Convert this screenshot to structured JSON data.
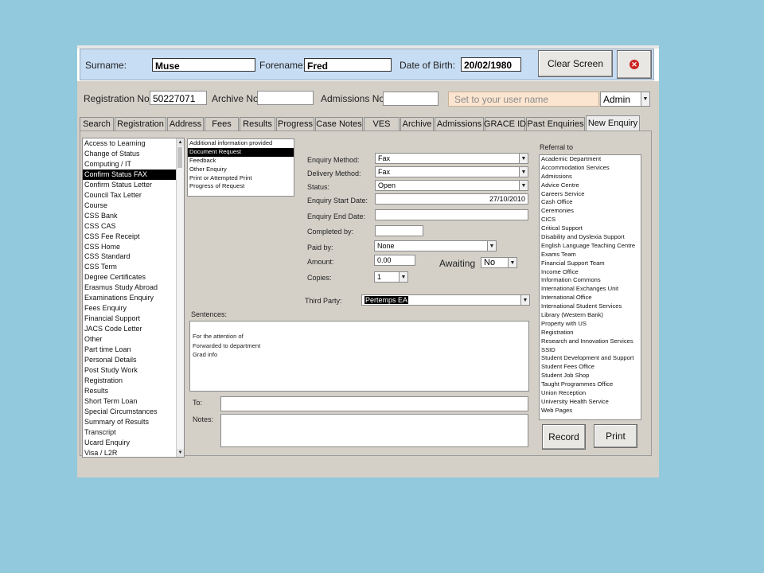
{
  "header": {
    "surname_label": "Surname:",
    "surname_value": "Muse",
    "forename_label": "Forename:",
    "forename_value": "Fred",
    "dob_label": "Date of Birth:",
    "dob_value": "20/02/1980",
    "clear_label": "Clear Screen"
  },
  "reg": {
    "registration_label": "Registration No.",
    "registration_value": "50227071",
    "archive_label": "Archive No:",
    "archive_value": "",
    "admissions_label": "Admissions No:",
    "admissions_value": "",
    "user_placeholder": "Set to your user name",
    "user_select": "Admin"
  },
  "tabs": [
    {
      "label": "Search"
    },
    {
      "label": "Registration"
    },
    {
      "label": "Address"
    },
    {
      "label": "Fees"
    },
    {
      "label": "Results"
    },
    {
      "label": "Progress"
    },
    {
      "label": "Case Notes"
    },
    {
      "label": "VES"
    },
    {
      "label": "Archive"
    },
    {
      "label": "Admissions"
    },
    {
      "label": "GRACE ID"
    },
    {
      "label": "Past Enquiries"
    },
    {
      "label": "New Enquiry"
    }
  ],
  "enquiry_types": [
    "Access to Learning",
    "Change of Status",
    "Computing / IT",
    "Confirm Status FAX",
    "Confirm Status Letter",
    "Council Tax Letter",
    "Course",
    "CSS Bank",
    "CSS CAS",
    "CSS Fee Receipt",
    "CSS Home",
    "CSS Standard",
    "CSS Term",
    "Degree Certificates",
    "Erasmus Study Abroad",
    "Examinations Enquiry",
    "Fees  Enquiry",
    "Financial Support",
    "JACS Code Letter",
    "Other",
    "Part time Loan",
    "Personal Details",
    "Post Study Work",
    "Registration",
    "Results",
    "Short Term Loan",
    "Special Circumstances",
    "Summary of Results",
    "Transcript",
    "Ucard Enquiry",
    "Visa / L2R"
  ],
  "sub_types": [
    "Additional information provided",
    "Document Request",
    "Feedback",
    "Other Enquiry",
    "Print or Attempted Print",
    "Progress of Request"
  ],
  "form": {
    "method_label": "Enquiry Method:",
    "method_value": "Fax",
    "delivery_label": "Delivery Method:",
    "delivery_value": "Fax",
    "status_label": "Status:",
    "status_value": "Open",
    "start_label": "Enquiry Start Date:",
    "start_value": "27/10/2010",
    "end_label": "Enquiry End Date:",
    "end_value": "",
    "completed_label": "Completed by:",
    "completed_value": "",
    "paid_label": "Paid by:",
    "paid_value": "None",
    "amount_label": "Amount:",
    "amount_value": "0.00",
    "awaiting_label": "Awaiting",
    "awaiting_value": "No",
    "copies_label": "Copies:",
    "copies_value": "1",
    "third_party_label": "Third Party:",
    "third_party_value": "Pertemps EA",
    "sentences_label": "Sentences:",
    "sentences": [
      "For the attention of",
      "Forwarded to department",
      "Grad info"
    ],
    "to_label": "To:",
    "to_value": "",
    "notes_label": "Notes:",
    "notes_value": ""
  },
  "referral": {
    "label": "Referral to",
    "items": [
      "Academic Department",
      "Accommodation Services",
      "Admissions",
      "Advice Centre",
      "Careers Service",
      "Cash Office",
      "Ceremonies",
      "CICS",
      "Critical Support",
      "Disability and Dyslexia Support",
      "English Language Teaching Centre",
      "Exams Team",
      "Financial Support Team",
      "Income Office",
      "Information Commons",
      "International Exchanges Unit",
      "International Office",
      "International Student Services",
      "Library (Western Bank)",
      "Property with US",
      "Registration",
      "Research and Innovation Services",
      "SSID",
      "Student Development and Support",
      "Student Fees Office",
      "Student Job Shop",
      "Taught Programmes Office",
      "Union Reception",
      "University Health Service",
      "Web Pages"
    ]
  },
  "actions": {
    "record_label": "Record",
    "print_label": "Print"
  },
  "colors": {
    "header_bg": "#c7ddf4",
    "panel_bg": "#d4d0c8",
    "page_bg": "#92c9dc",
    "close_red": "#cc2222"
  }
}
